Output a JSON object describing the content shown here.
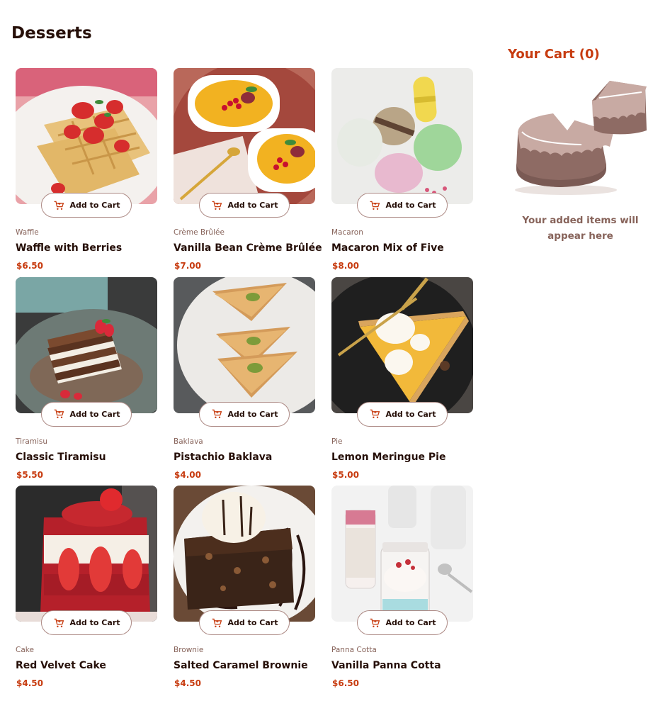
{
  "page": {
    "title": "Desserts"
  },
  "add_to_cart_label": "Add to Cart",
  "products": [
    {
      "category": "Waffle",
      "name": "Waffle with Berries",
      "price": "$6.50"
    },
    {
      "category": "Crème Brûlée",
      "name": "Vanilla Bean Crème Brûlée",
      "price": "$7.00"
    },
    {
      "category": "Macaron",
      "name": "Macaron Mix of Five",
      "price": "$8.00"
    },
    {
      "category": "Tiramisu",
      "name": "Classic Tiramisu",
      "price": "$5.50"
    },
    {
      "category": "Baklava",
      "name": "Pistachio Baklava",
      "price": "$4.00"
    },
    {
      "category": "Pie",
      "name": "Lemon Meringue Pie",
      "price": "$5.00"
    },
    {
      "category": "Cake",
      "name": "Red Velvet Cake",
      "price": "$4.50"
    },
    {
      "category": "Brownie",
      "name": "Salted Caramel Brownie",
      "price": "$4.50"
    },
    {
      "category": "Panna Cotta",
      "name": "Vanilla Panna Cotta",
      "price": "$6.50"
    }
  ],
  "cart": {
    "title": "Your Cart (0)",
    "empty_message": "Your added items will appear here"
  },
  "colors": {
    "accent": "#c73b0f",
    "text_dark": "#260f08",
    "text_muted": "#87635a",
    "button_border": "#ad8a85"
  },
  "icons": {
    "add_to_cart": "add-to-cart-icon",
    "empty_cart": "empty-cart-cake-illustration"
  }
}
